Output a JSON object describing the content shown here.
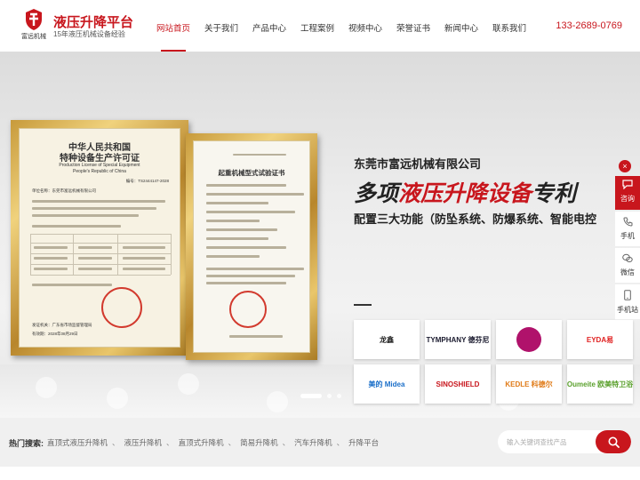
{
  "header": {
    "logo_text": "富远机械",
    "site_name": "液压升降平台",
    "tagline": "15年液压机械设备经验",
    "phone": "133-2689-0769"
  },
  "nav": {
    "items": [
      {
        "label": "网站首页",
        "active": true
      },
      {
        "label": "关于我们",
        "active": false
      },
      {
        "label": "产品中心",
        "active": false
      },
      {
        "label": "工程案例",
        "active": false
      },
      {
        "label": "视频中心",
        "active": false
      },
      {
        "label": "荣誉证书",
        "active": false
      },
      {
        "label": "新闻中心",
        "active": false
      },
      {
        "label": "联系我们",
        "active": false
      }
    ]
  },
  "banner": {
    "company_name": "东莞市富远机械有限公司",
    "headline_dark_1": "多项",
    "headline_red": "液压升降设备",
    "headline_dark_2": "专利",
    "subline": "配置三大功能（防坠系统、防爆系统、智能电控",
    "certificate_1": {
      "title_1": "中华人民共和国",
      "title_2": "特种设备生产许可证",
      "title_en_1": "Production License of Special Equipment",
      "title_en_2": "People's Republic of China",
      "number": "编号：TS2444147-2028",
      "company_line": "单位名称：东莞市富远机械有限公司",
      "footer": "发证机关：广东省市场监督管理局",
      "dates": "有效期：2028年08月29日"
    },
    "certificate_2": {
      "title": "起重机械型式试验证书"
    },
    "partner_logos": [
      {
        "name": "龙鑫",
        "color": "#222222"
      },
      {
        "name": "TYMPHANY 德芬尼",
        "color": "#1a1a2e"
      },
      {
        "name": "",
        "color": "#b0126b"
      },
      {
        "name": "EYDA易",
        "color": "#e02020"
      },
      {
        "name": "美的 Midea",
        "color": "#1b6fc9"
      },
      {
        "name": "SINOSHIELD",
        "color": "#c8161d"
      },
      {
        "name": "KEDLE 科德尔",
        "color": "#e07b18"
      },
      {
        "name": "Oumeite 欧美特卫浴",
        "color": "#5aa02c"
      }
    ],
    "slide_count": 3,
    "active_slide": 1
  },
  "sidebar": {
    "close_glyph": "×",
    "consult_label": "咨询",
    "items": [
      {
        "label": "手机",
        "icon": "phone-icon"
      },
      {
        "label": "微信",
        "icon": "wechat-icon"
      },
      {
        "label": "手机站",
        "icon": "mobile-site-icon"
      }
    ]
  },
  "hot_search": {
    "label": "热门搜索:",
    "links": [
      "直顶式液压升降机",
      "液压升降机",
      "直顶式升降机",
      "简易升降机",
      "汽车升降机",
      "升降平台"
    ],
    "placeholder": "输入关键词查找产品"
  },
  "colors": {
    "brand_red": "#c8161d",
    "gold_frame": "#c79a3b"
  }
}
